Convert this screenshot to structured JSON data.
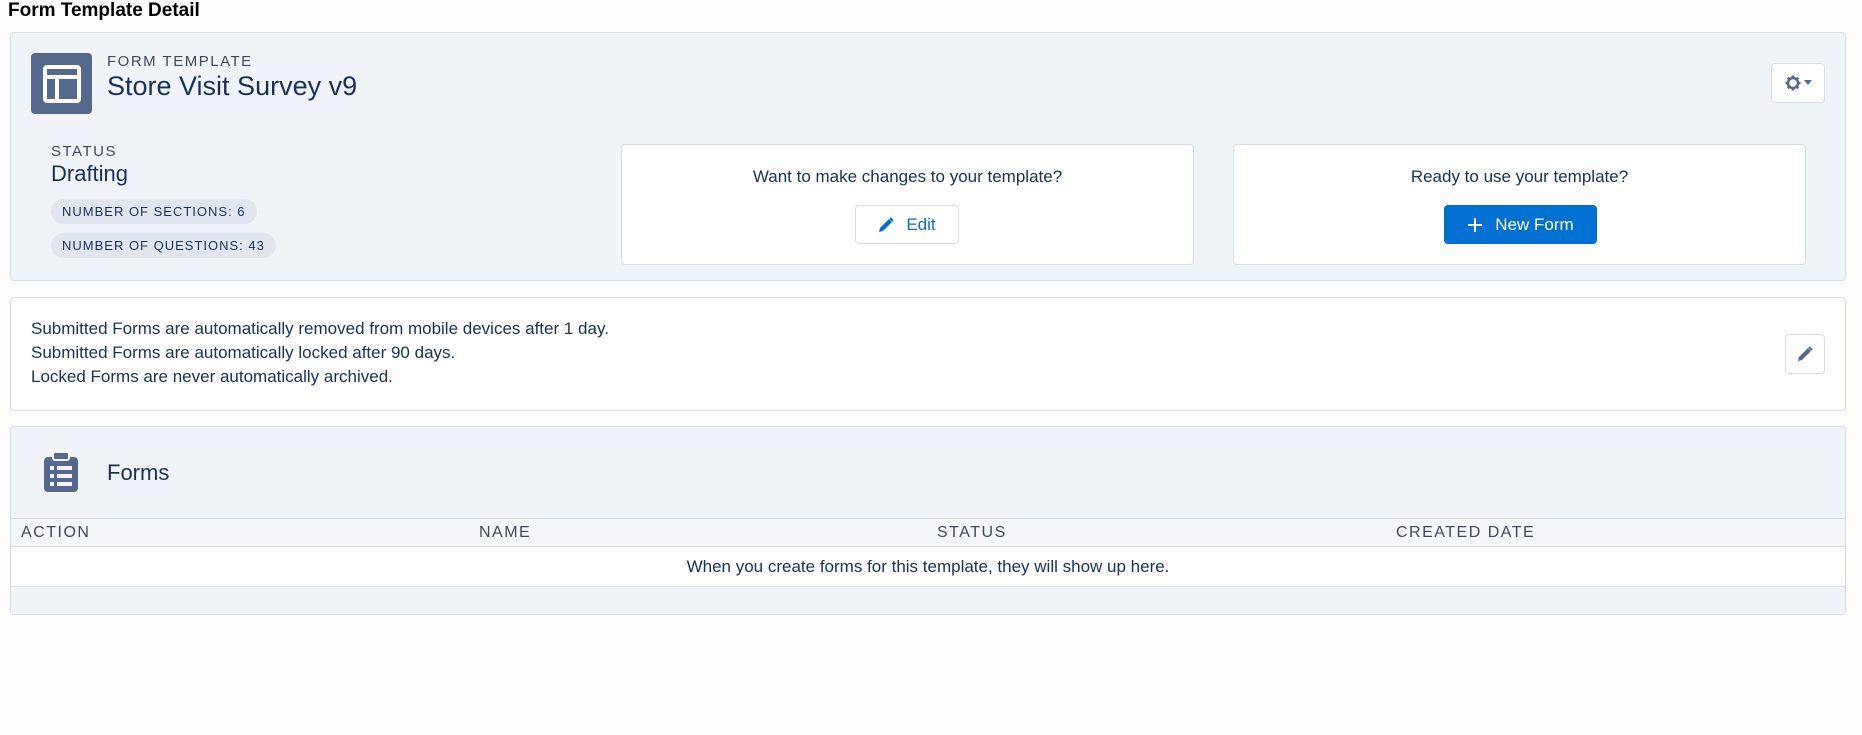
{
  "page": {
    "title": "Form Template Detail"
  },
  "header": {
    "eyebrow": "FORM TEMPLATE",
    "name": "Store Visit Survey v9",
    "settings_icon": "gear-icon"
  },
  "status": {
    "label": "STATUS",
    "value": "Drafting",
    "sections_pill": "NUMBER OF SECTIONS: 6",
    "questions_pill": "NUMBER OF QUESTIONS: 43"
  },
  "edit_panel": {
    "prompt": "Want to make changes to your template?",
    "button_label": "Edit"
  },
  "new_panel": {
    "prompt": "Ready to use your template?",
    "button_label": "New Form"
  },
  "policy": {
    "lines": [
      "Submitted Forms are automatically removed from mobile devices after 1 day.",
      "Submitted Forms are automatically locked after 90 days.",
      "Locked Forms are never automatically archived."
    ]
  },
  "forms": {
    "title": "Forms",
    "columns": [
      "ACTION",
      "NAME",
      "STATUS",
      "CREATED DATE"
    ],
    "empty_message": "When you create forms for this template, they will show up here."
  },
  "colors": {
    "brand": "#0070d2",
    "text": "#16325c",
    "icon_bg": "#54698d",
    "card_bg": "#f0f3f7"
  }
}
